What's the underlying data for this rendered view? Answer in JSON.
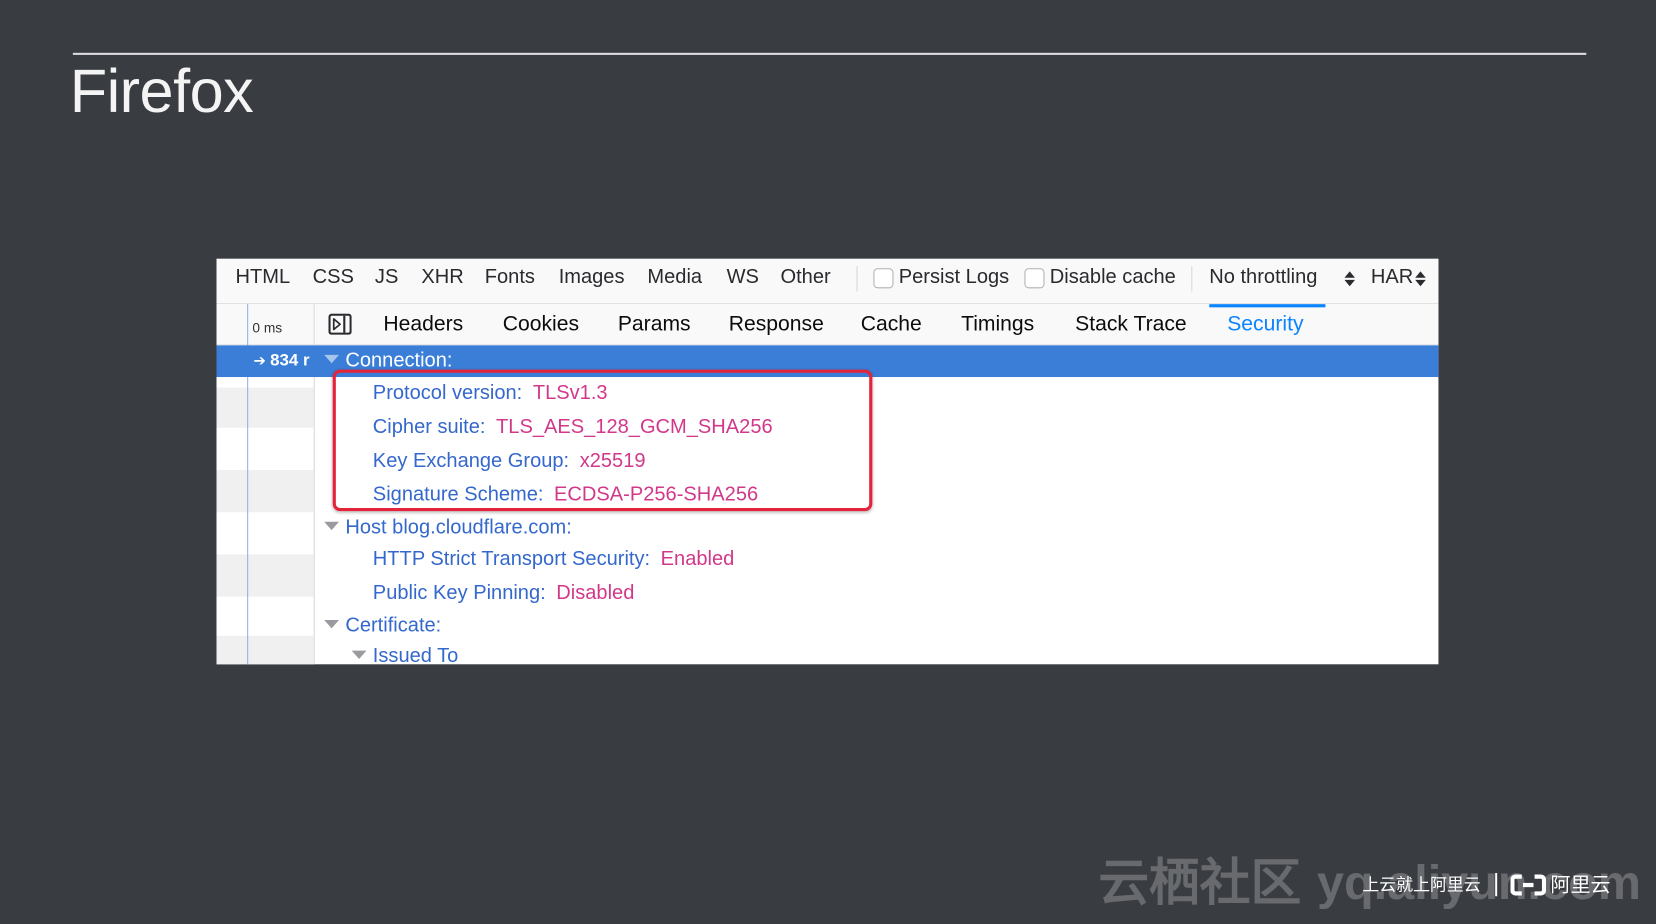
{
  "slide": {
    "title": "Firefox"
  },
  "devtools": {
    "filters": [
      "HTML",
      "CSS",
      "JS",
      "XHR",
      "Fonts",
      "Images",
      "Media",
      "WS",
      "Other"
    ],
    "persist_logs": {
      "label": "Persist Logs",
      "checked": false
    },
    "disable_cache": {
      "label": "Disable cache",
      "checked": false
    },
    "throttling": {
      "selected": "No throttling"
    },
    "har": {
      "label": "HAR"
    },
    "request_list": {
      "timeline_label": "0 ms",
      "selected_request_icon": "arrow-right-icon",
      "selected_request": "834 r"
    },
    "sidebar_toggle_icon": "sidebar-toggle-icon",
    "tabs": [
      {
        "label": "Headers"
      },
      {
        "label": "Cookies"
      },
      {
        "label": "Params"
      },
      {
        "label": "Response"
      },
      {
        "label": "Cache"
      },
      {
        "label": "Timings"
      },
      {
        "label": "Stack Trace"
      },
      {
        "label": "Security",
        "selected": true
      }
    ],
    "security": {
      "connection": {
        "heading": "Connection:",
        "fields": [
          {
            "label": "Protocol version:",
            "value": "TLSv1.3"
          },
          {
            "label": "Cipher suite:",
            "value": "TLS_AES_128_GCM_SHA256"
          },
          {
            "label": "Key Exchange Group:",
            "value": "x25519"
          },
          {
            "label": "Signature Scheme:",
            "value": "ECDSA-P256-SHA256"
          }
        ]
      },
      "host": {
        "heading": "Host blog.cloudflare.com:",
        "fields": [
          {
            "label": "HTTP Strict Transport Security:",
            "value": "Enabled"
          },
          {
            "label": "Public Key Pinning:",
            "value": "Disabled"
          }
        ]
      },
      "certificate": {
        "heading": "Certificate:",
        "issued_to": {
          "heading": "Issued To"
        }
      }
    }
  },
  "colors": {
    "background": "#393c41",
    "label": "#3468cc",
    "value": "#d1388a",
    "selection": "#3a7ed8",
    "active_tab": "#0a84ff",
    "highlight": "#e3243b"
  },
  "watermark": {
    "site_name": "云栖社区",
    "url": "yq.aliyun.com"
  },
  "footer": {
    "slogan": "上云就上阿里云",
    "separator": "|",
    "logo_icon": "aliyun-logo-icon",
    "brand": "阿里云"
  }
}
